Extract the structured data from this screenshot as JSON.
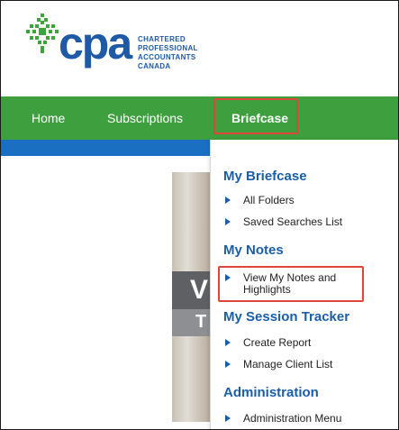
{
  "logo": {
    "wordmark": "cpa",
    "subtitle_lines": [
      "CHARTERED",
      "PROFESSIONAL",
      "ACCOUNTANTS",
      "CANADA"
    ]
  },
  "nav": {
    "items": [
      {
        "label": "Home"
      },
      {
        "label": "Subscriptions"
      },
      {
        "label": "Briefcase"
      }
    ],
    "active": "Briefcase"
  },
  "hero": {
    "letter1": "V",
    "letter2": "T"
  },
  "dropdown": {
    "sections": [
      {
        "title": "My Briefcase",
        "items": [
          "All Folders",
          "Saved Searches List"
        ]
      },
      {
        "title": "My Notes",
        "items": [
          "View My Notes and",
          "Highlights"
        ]
      },
      {
        "title": "My Session Tracker",
        "items": [
          "Create Report",
          "Manage Client List"
        ]
      },
      {
        "title": "Administration",
        "items": [
          "Administration Menu"
        ]
      }
    ]
  },
  "colors": {
    "nav_green": "#3e9f3e",
    "brand_blue": "#1f5aa6",
    "section_blue": "#1a5ea8",
    "highlight_red": "#e0453a",
    "strip_blue": "#1b6fc2"
  }
}
